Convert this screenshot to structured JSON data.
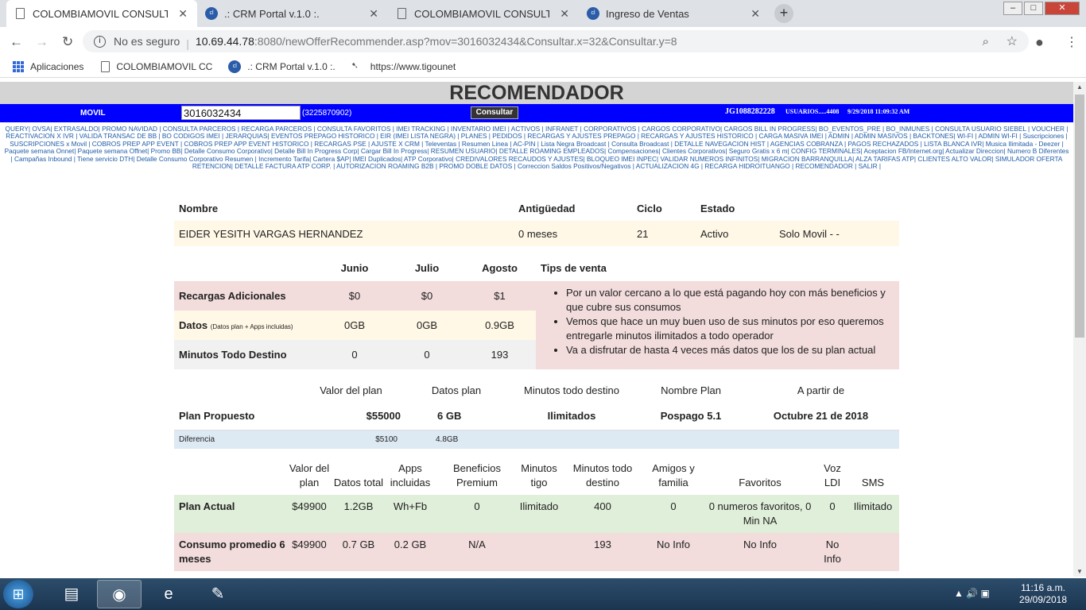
{
  "browser": {
    "tabs": [
      {
        "title": "COLOMBIAMOVIL CONSULTA IN",
        "icon": "document-icon",
        "active": true
      },
      {
        "title": ".: CRM Portal v.1.0 :.",
        "icon": "claro-icon",
        "active": false
      },
      {
        "title": "COLOMBIAMOVIL CONSULTA IN",
        "icon": "document-icon",
        "active": false
      },
      {
        "title": "Ingreso de Ventas",
        "icon": "claro-icon",
        "active": false
      }
    ],
    "not_secure": "No es seguro",
    "url_host": "10.69.44.78",
    "url_rest": ":8080/newOfferRecommender.asp?mov=3016032434&Consultar.x=32&Consultar.y=8",
    "bookmarks": [
      "Aplicaciones",
      "COLOMBIAMOVIL CC",
      ".: CRM Portal v.1.0 :.",
      "https://www.tigounet"
    ]
  },
  "page": {
    "title": "RECOMENDADOR",
    "movil_label": "MOVIL",
    "phone": "3016032434",
    "alt_phone": "(3225870902)",
    "consultar": "Consultar",
    "user": "JG1088282228",
    "usuarios": "USUARIOS.....4408",
    "timestamp": "9/29/2018 11:09:32 AM",
    "menu": "QUERY| OVSA| EXTRASALDO| PROMO NAVIDAD | CONSULTA PARCEROS | RECARGA PARCEROS | CONSULTA FAVORITOS | IMEI TRACKING | INVENTARIO IMEI | ACTIVOS | INFRANET | CORPORATIVOS | CARGOS CORPORATIVO| CARGOS BILL IN PROGRESS| BO_EVENTOS_PRE | BO_INMUNES | CONSULTA USUARIO SIEBEL | VOUCHER | REACTIVACION X IVR | VALIDA TRANSAC DE BB | BO CODIGOS IMEI | JERARQUIAS| EVENTOS PREPAGO HISTORICO | EIR (IMEI LISTA NEGRA) | PLANES | PEDIDOS | RECARGAS Y AJUSTES PREPAGO | RECARGAS Y AJUSTES HISTORICO | CARGA MASIVA IMEI | ADMIN | ADMIN MASIVOS | BACKTONES| WI-FI | ADMIN WI-FI | Suscripciones | SUSCRIPCIONES x Movil | COBROS PREP APP EVENT | COBROS PREP APP EVENT HISTORICO | RECARGAS PSE | AJUSTE X CRM | Televentas | Resumen Linea | AC-PIN | Lista Negra Broadcast | Consulta Broadcast | DETALLE NAVEGACION HIST | AGENCIAS COBRANZA | PAGOS RECHAZADOS | LISTA BLANCA IVR| Musica Ilimitada - Deezer | Paquete semana Onnet| Paquete semana Offnet| Promo BB| Detalle Consumo Corporativo| Detalle Bill In Progress Corp| Cargar Bill In Progress| RESUMEN USUARIO| DETALLE ROAMING EMPLEADOS| Compensaciones| Clientes Corporativos| Seguro Gratis x 6 m| CONFIG TERMINALES| Aceptacion FB/Internet.org| Actualizar Direccion| Numero B Diferentes | Campañas Inbound | Tiene servicio DTH| Detalle Consumo Corporativo Resumen | Incremento Tarifa| Cartera $AP| IMEI Duplicados| ATP Corporativo| CREDIVALORES RECAUDOS Y AJUSTES| BLOQUEO IMEI INPEC| VALIDAR NUMEROS INFINITOS| MIGRACION BARRANQUILLA| ALZA TARIFAS ATP| CLIENTES ALTO VALOR| SIMULADOR OFERTA RETENCION| DETALLE FACTURA ATP CORP. | AUTORIZACION ROAMING B2B | PROMO DOBLE DATOS | Correccion Saldos Positivos/Negativos | ACTUALIZACION 4G | RECARGA HIDROITUANGO | RECOMENDADOR | SALIR |"
  },
  "customer": {
    "headers": [
      "Nombre",
      "Antigüedad",
      "Ciclo",
      "Estado"
    ],
    "name": "EIDER YESITH VARGAS HERNANDEZ",
    "antiguedad": "0 meses",
    "ciclo": "21",
    "estado": "Activo",
    "tipo": "Solo Movil - -"
  },
  "consumo": {
    "months": [
      "Junio",
      "Julio",
      "Agosto"
    ],
    "tips_header": "Tips de venta",
    "rows": [
      {
        "label": "Recargas Adicionales",
        "note": "",
        "values": [
          "$0",
          "$0",
          "$1"
        ]
      },
      {
        "label": "Datos",
        "note": "(Datos plan + Apps incluidas)",
        "values": [
          "0GB",
          "0GB",
          "0.9GB"
        ]
      },
      {
        "label": "Minutos Todo Destino",
        "note": "",
        "values": [
          "0",
          "0",
          "193"
        ]
      }
    ],
    "tips": [
      "Por un valor cercano a lo que está pagando hoy con más beneficios y que cubre sus consumos",
      "Vemos que hace un muy buen uso de sus minutos por eso queremos entregarle minutos ilimitados a todo operador",
      "Va a disfrutar de hasta 4 veces más datos que los de su plan actual"
    ]
  },
  "propuesto": {
    "headers": [
      "Valor del plan",
      "Datos plan",
      "Minutos todo destino",
      "Nombre Plan",
      "A partir de"
    ],
    "label": "Plan Propuesto",
    "valor": "$55000",
    "datos": "6 GB",
    "minutos": "Ilimitados",
    "nombre": "Pospago 5.1",
    "desde": "Octubre 21 de 2018",
    "diff_label": "Diferencia",
    "diff_valor": "$5100",
    "diff_datos": "4.8GB"
  },
  "actual": {
    "headers": [
      "Valor del plan",
      "Datos total",
      "Apps incluidas",
      "Beneficios Premium",
      "Minutos tigo",
      "Minutos todo destino",
      "Amigos y familia",
      "Favoritos",
      "Voz LDI",
      "SMS"
    ],
    "rows": [
      {
        "label": "Plan Actual",
        "values": [
          "$49900",
          "1.2GB",
          "Wh+Fb",
          "0",
          "Ilimitado",
          "400",
          "0",
          "0 numeros favoritos, 0 Min NA",
          "0",
          "Ilimitado"
        ]
      },
      {
        "label": "Consumo promedio 6 meses",
        "values": [
          "$49900",
          "0.7 GB",
          "0.2 GB",
          "N/A",
          "",
          "193",
          "No Info",
          "No Info",
          "No Info",
          ""
        ]
      }
    ]
  },
  "taskbar": {
    "time": "11:16 a.m.",
    "date": "29/09/2018"
  }
}
